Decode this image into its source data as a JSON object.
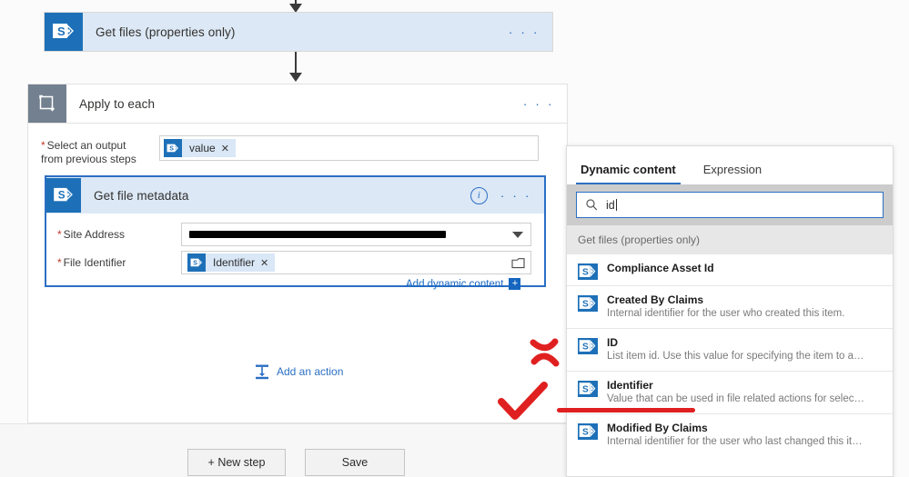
{
  "flow": {
    "step_get_files": {
      "title": "Get files (properties only)",
      "icon": "sharepoint-icon",
      "menu": "· · ·"
    },
    "apply_to_each": {
      "title": "Apply to each",
      "icon": "foreach-loop-icon",
      "menu": "· · ·",
      "output_label_line1": "Select an output",
      "output_label_line2": "from previous steps",
      "required_mark": "*",
      "output_token": {
        "label": "value",
        "remove": "✕",
        "icon": "sharepoint-icon"
      }
    },
    "get_file_metadata": {
      "title": "Get file metadata",
      "icon": "sharepoint-icon",
      "info": "i",
      "menu": "· · ·",
      "site_address_label": "Site Address",
      "site_address_value": "",
      "file_identifier_label": "File Identifier",
      "file_identifier_token": {
        "label": "Identifier",
        "remove": "✕",
        "icon": "sharepoint-icon"
      },
      "add_dynamic_content": "Add dynamic content",
      "add_dynamic_plus": "+",
      "required_mark": "*"
    },
    "add_an_action": "Add an action",
    "toolbar": {
      "new_step": "+ New step",
      "save": "Save"
    }
  },
  "panel": {
    "tabs": [
      {
        "label": "Dynamic content",
        "active": true
      },
      {
        "label": "Expression",
        "active": false
      }
    ],
    "search": {
      "value": "id",
      "placeholder": ""
    },
    "group_title": "Get files (properties only)",
    "items": [
      {
        "name": "Compliance Asset Id",
        "desc": "",
        "icon": "sharepoint-icon"
      },
      {
        "name": "Created By Claims",
        "desc": "Internal identifier for the user who created this item.",
        "icon": "sharepoint-icon"
      },
      {
        "name": "ID",
        "desc": "List item id. Use this value for specifying the item to act on i...",
        "icon": "sharepoint-icon"
      },
      {
        "name": "Identifier",
        "desc": "Value that can be used in file related actions for selecting a fi...",
        "icon": "sharepoint-icon"
      },
      {
        "name": "Modified By Claims",
        "desc": "Internal identifier for the user who last changed this item.",
        "icon": "sharepoint-icon"
      }
    ]
  },
  "annotations": {
    "cross": "red-x-mark",
    "check": "red-check-mark",
    "underline": "red-underline-identifier"
  },
  "colors": {
    "sharepoint_blue": "#1d70b8",
    "card_header_blue": "#dce8f5",
    "accent_blue": "#2b6fc4",
    "loop_tile_gray": "#73808f",
    "annotation_red": "#e02020"
  }
}
